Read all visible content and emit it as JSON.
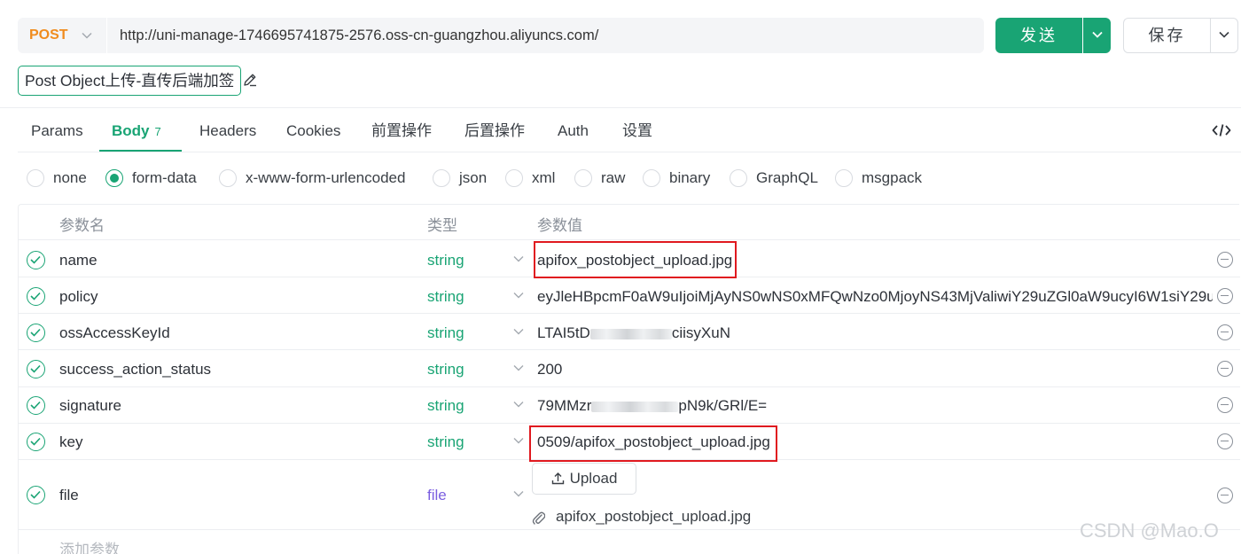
{
  "request": {
    "method": "POST",
    "url": "http://uni-manage-1746695741875-2576.oss-cn-guangzhou.aliyuncs.com/",
    "send_label": "发送",
    "save_label": "保存",
    "name": "Post Object上传-直传后端加签"
  },
  "tabs": [
    {
      "label": "Params"
    },
    {
      "label": "Body",
      "badge": "7"
    },
    {
      "label": "Headers"
    },
    {
      "label": "Cookies"
    },
    {
      "label": "前置操作"
    },
    {
      "label": "后置操作"
    },
    {
      "label": "Auth"
    },
    {
      "label": "设置"
    }
  ],
  "active_tab": "Body",
  "body_types": [
    "none",
    "form-data",
    "x-www-form-urlencoded",
    "json",
    "xml",
    "raw",
    "binary",
    "GraphQL",
    "msgpack"
  ],
  "selected_body_type": "form-data",
  "table": {
    "headers": {
      "name": "参数名",
      "type": "类型",
      "value": "参数值"
    },
    "rows": [
      {
        "name": "name",
        "type": "string",
        "value": "apifox_postobject_upload.jpg"
      },
      {
        "name": "policy",
        "type": "string",
        "value": "eyJleHBpcmF0aW9uIjoiMjAyNS0wNS0xMFQwNzo0MjoyNS43MjValiwiY29uZGl0aW9ucyI6W1siY29u"
      },
      {
        "name": "ossAccessKeyId",
        "type": "string",
        "value_prefix": "LTAI5tD",
        "value_suffix": "ciisyXuN"
      },
      {
        "name": "success_action_status",
        "type": "string",
        "value": "200"
      },
      {
        "name": "signature",
        "type": "string",
        "value_prefix": "79MMzr",
        "value_suffix": "pN9k/GRl/E="
      },
      {
        "name": "key",
        "type": "string",
        "value": "0509/apifox_postobject_upload.jpg"
      },
      {
        "name": "file",
        "type": "file",
        "upload_label": "Upload",
        "file_name": "apifox_postobject_upload.jpg"
      }
    ],
    "add_param_placeholder": "添加参数"
  },
  "watermark": "CSDN @Mao.O",
  "colors": {
    "accent": "#19a474",
    "method": "#f08c1e",
    "file_type": "#7b5fe0",
    "highlight": "#e0191f"
  }
}
